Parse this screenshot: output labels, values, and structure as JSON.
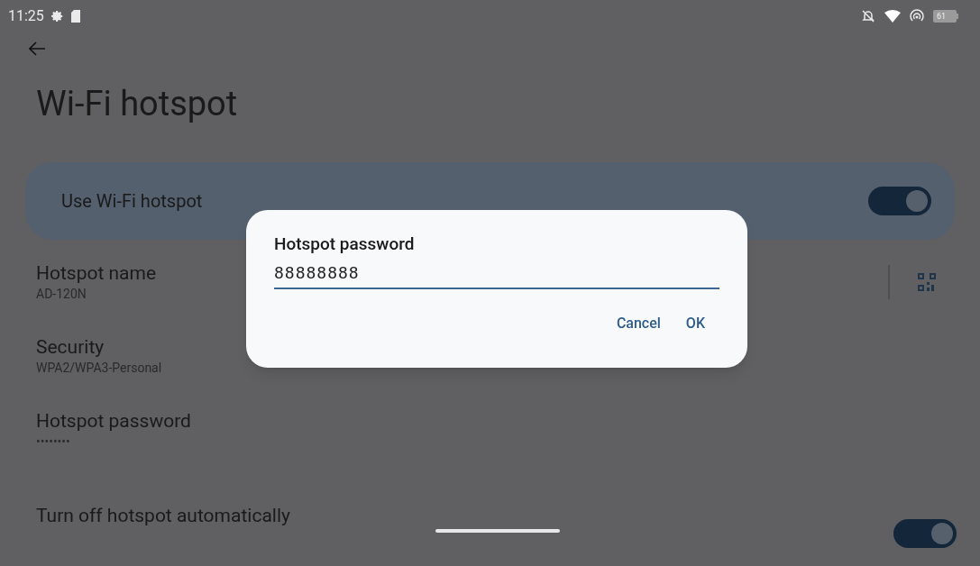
{
  "status_bar": {
    "time": "11:25",
    "battery": "61"
  },
  "title": "Wi-Fi hotspot",
  "main_switch": {
    "label": "Use Wi-Fi hotspot",
    "on": true
  },
  "settings": [
    {
      "kind": "qr",
      "title": "Hotspot name",
      "subtitle": "AD-120N"
    },
    {
      "kind": "text",
      "title": "Security",
      "subtitle": "WPA2/WPA3-Personal"
    },
    {
      "kind": "text",
      "title": "Hotspot password",
      "subtitle": "••••••••"
    },
    {
      "kind": "switch",
      "title": "Turn off hotspot automatically",
      "on": true
    }
  ],
  "dialog": {
    "title": "Hotspot password",
    "value": "88888888",
    "buttons": [
      "Cancel",
      "OK"
    ]
  }
}
